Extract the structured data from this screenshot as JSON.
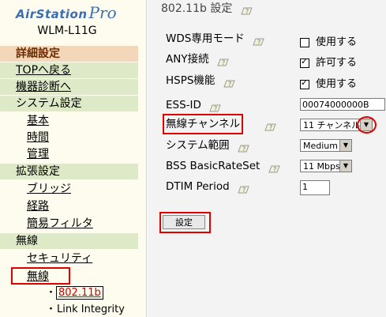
{
  "logo": {
    "brand": "AirStation",
    "pro": "Pro"
  },
  "model": "WLM-L11G",
  "sidebar": {
    "items": [
      {
        "label": "詳細設定"
      },
      {
        "label": "TOPへ戻る"
      },
      {
        "label": "機器診断へ"
      },
      {
        "label": "システム設定"
      },
      {
        "label": "基本"
      },
      {
        "label": "時間"
      },
      {
        "label": "管理"
      },
      {
        "label": "拡張設定"
      },
      {
        "label": "ブリッジ"
      },
      {
        "label": "経路"
      },
      {
        "label": "簡易フィルタ"
      },
      {
        "label": "無線"
      },
      {
        "label": "セキュリティ"
      },
      {
        "label": "無線"
      }
    ],
    "sub": [
      {
        "label": "802.11b"
      },
      {
        "label": "Link Integrity"
      }
    ],
    "bullet": "・"
  },
  "main": {
    "title": "802.11b 設定",
    "wds_label": "WDS専用モード",
    "wds_value": "使用する",
    "any_label": "ANY接続",
    "any_value": "許可する",
    "hsps_label": "HSPS機能",
    "hsps_value": "使用する",
    "essid_label": "ESS-ID",
    "essid_value": "00074000000B",
    "channel_label": "無線チャンネル",
    "channel_value": "11 チャンネル",
    "range_label": "システム範囲",
    "range_value": "Medium",
    "bss_label": "BSS BasicRateSet",
    "bss_value": "11 Mbps",
    "dtim_label": "DTIM Period",
    "dtim_value": "1",
    "submit_label": "設定"
  },
  "colors": {
    "highlight": "#e00000",
    "accent": "#3a6fb5"
  }
}
